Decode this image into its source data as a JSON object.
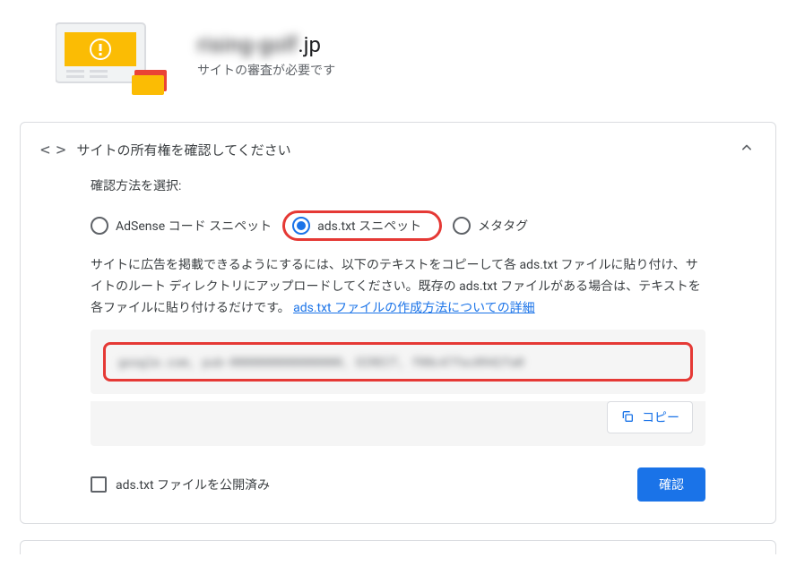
{
  "header": {
    "domain_blurred": "rising-golf",
    "domain_suffix": ".jp",
    "subtitle": "サイトの審査が必要です"
  },
  "card": {
    "title": "サイトの所有権を確認してください",
    "method_label": "確認方法を選択:",
    "radios": {
      "adsense": "AdSense コード スニペット",
      "adstxt": "ads.txt スニペット",
      "meta": "メタタグ"
    },
    "help_text_pre": "サイトに広告を掲載できるようにするには、以下のテキストをコピーして各 ads.txt ファイルに貼り付け、サイトのルート ディレクトリにアップロードしてください。既存の ads.txt ファイルがある場合は、テキストを各ファイルに貼り付けるだけです。 ",
    "help_link": "ads.txt ファイルの作成方法についての詳細",
    "code_blurred": "google.com, pub-0000000000000000, DIRECT, f08c47fec0942fa0",
    "copy_label": "コピー",
    "checkbox_label": "ads.txt ファイルを公開済み",
    "confirm_label": "確認"
  }
}
